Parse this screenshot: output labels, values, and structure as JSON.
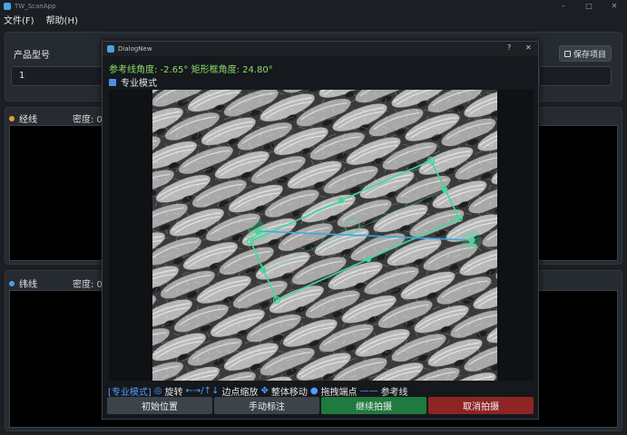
{
  "window": {
    "title": "TW_ScanApp",
    "controls": [
      "–",
      "□",
      "✕"
    ]
  },
  "menu": [
    {
      "label": "文件(F)"
    },
    {
      "label": "帮助(H)"
    }
  ],
  "top_panel": {
    "product_label": "产品型号",
    "product_value": "1",
    "save_label": "保存项目"
  },
  "warp": {
    "title": "经线",
    "density": "密度: 0",
    "dot_color": "#e0a030"
  },
  "weft": {
    "title": "纬线",
    "density": "密度: 0",
    "dot_color": "#4a9fe0"
  },
  "dialog": {
    "title": "DialogNew",
    "help_btn": "?",
    "close_btn": "✕",
    "angle_text": "参考线角度: -2.65° 矩形框角度: 24.80°",
    "pro_mode_label": "专业模式",
    "pro_mode_checked": true,
    "help": {
      "tag": "[专业模式]",
      "rotate_sym": "◎",
      "rotate": "旋转",
      "scale_sym": "←→/↑↓",
      "scale": "边点缩放",
      "move_sym": "✥",
      "move": "整体移动",
      "drag_sym": "●",
      "drag": "拖拽端点",
      "line_sym": "——",
      "line": "参考线"
    },
    "buttons": [
      {
        "label": "初始位置"
      },
      {
        "label": "手动标注"
      },
      {
        "label": "继续拍摄"
      },
      {
        "label": "取消拍摄"
      }
    ]
  },
  "colors": {
    "accent_green": "#8fdc6a",
    "overlay_green": "#3ddc97",
    "overlay_blue": "#3aa8e0",
    "continue_green": "#1f7a3e",
    "cancel_red": "#8e2424"
  }
}
